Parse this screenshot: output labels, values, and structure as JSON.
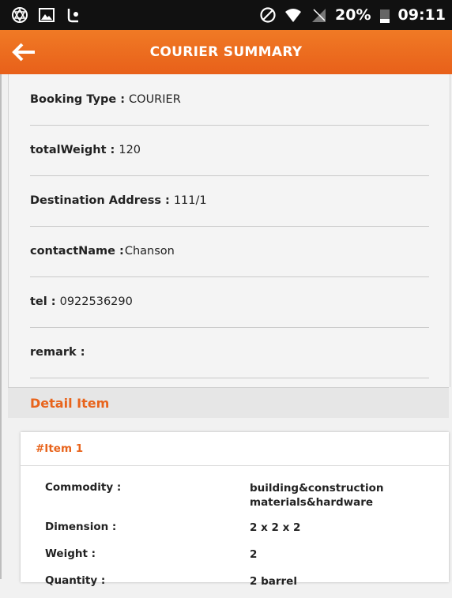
{
  "status_bar": {
    "battery_text": "20%",
    "time": "09:11"
  },
  "app_bar": {
    "title": "COURIER SUMMARY"
  },
  "summary": {
    "fields": [
      {
        "label": "Booking Type :",
        "value": "COURIER"
      },
      {
        "label": "totalWeight :",
        "value": "120"
      },
      {
        "label": "Destination Address :",
        "value": "111/1"
      },
      {
        "label": "contactName :",
        "value": "Chanson"
      },
      {
        "label": "tel :",
        "value": "0922536290"
      },
      {
        "label": "remark :",
        "value": ""
      }
    ]
  },
  "detail": {
    "title": "Detail Item",
    "item": {
      "title": "#Item 1",
      "rows": [
        {
          "label": "Commodity :",
          "value": "building&construction materials&hardware"
        },
        {
          "label": "Dimension :",
          "value": "2 x 2 x 2"
        },
        {
          "label": "Weight :",
          "value": "2"
        },
        {
          "label": "Quantity :",
          "value": "2 barrel"
        }
      ]
    }
  },
  "colors": {
    "accent": "#e8641c",
    "app_bar": "#f07a25",
    "status_bar": "#111111"
  }
}
